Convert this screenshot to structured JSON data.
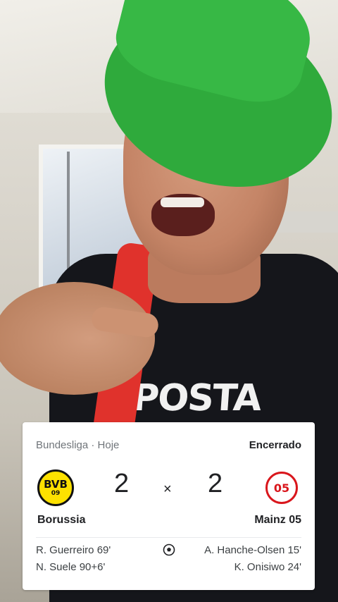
{
  "score_card": {
    "league_date": "Bundesliga · Hoje",
    "status": "Encerrado",
    "home": {
      "name": "Borussia",
      "score": "2",
      "logo_text": "BVB",
      "logo_year": "09",
      "scorers": [
        "R. Guerreiro 69'",
        "N. Suele 90+6'"
      ]
    },
    "separator": "×",
    "away": {
      "name": "Mainz 05",
      "score": "2",
      "logo_text": "05",
      "scorers": [
        "A. Hanche-Olsen 15'",
        "K. Onisiwo 24'"
      ]
    },
    "goal_icon": "soccer-ball-icon"
  },
  "video_overlay": {
    "shirt_print": "APOSTA"
  },
  "colors": {
    "hat": "#37b845",
    "strap": "#e0322c",
    "bvb_yellow": "#fde100",
    "mainz_red": "#d9161c"
  }
}
